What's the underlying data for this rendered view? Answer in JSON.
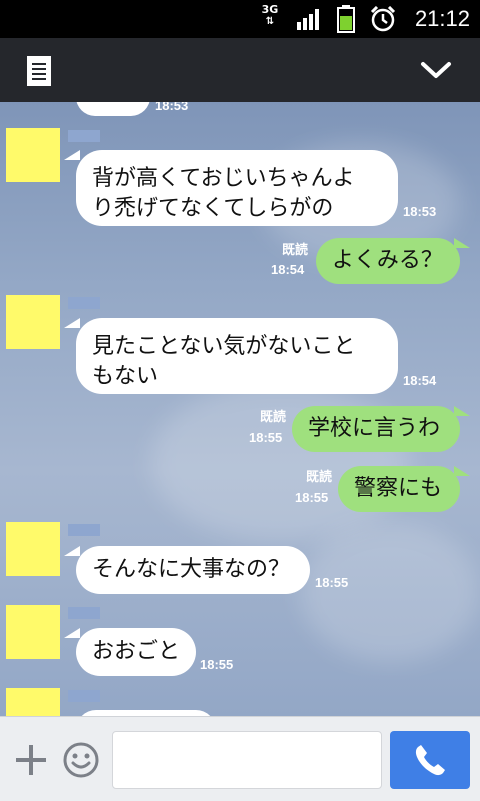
{
  "status_bar": {
    "network": "3G",
    "time": "21:12",
    "signal_icon": "signal-bars-icon",
    "battery_icon": "battery-icon",
    "alarm_icon": "alarm-clock-icon"
  },
  "header": {
    "menu_icon": "notes-list-icon",
    "collapse_icon": "chevron-down-icon",
    "background": "#25272c"
  },
  "messages": [
    {
      "dir": "in",
      "text": "",
      "time": "18:53"
    },
    {
      "dir": "in",
      "text": "背が高くておじいちゃんより禿げてなくてしらがの",
      "lines": [
        "背が高くておじいちゃんよ",
        "り禿げてなくてしらがの"
      ],
      "time": "18:53"
    },
    {
      "dir": "out",
      "text": "よくみる？",
      "read": "既読",
      "time": "18:54"
    },
    {
      "dir": "in",
      "text": "見たことない気がないこともない",
      "lines": [
        "見たことない気がないこと",
        "もない"
      ],
      "time": "18:54"
    },
    {
      "dir": "out",
      "text": "学校に言うわ",
      "read": "既読",
      "time": "18:55"
    },
    {
      "dir": "out",
      "text": "警察にも",
      "read": "既読",
      "time": "18:55"
    },
    {
      "dir": "in",
      "text": "そんなに大事なの？",
      "time": "18:55"
    },
    {
      "dir": "in",
      "text": "おおごと",
      "time": "18:55"
    }
  ],
  "input_bar": {
    "plus_icon": "plus-icon",
    "sticker_icon": "smiley-face-icon",
    "placeholder": "",
    "call_icon": "phone-icon"
  },
  "colors": {
    "incoming_bubble": "#ffffff",
    "outgoing_bubble": "#9fe07e",
    "avatar": "#fffa6a",
    "call_button": "#3f7fe6"
  }
}
